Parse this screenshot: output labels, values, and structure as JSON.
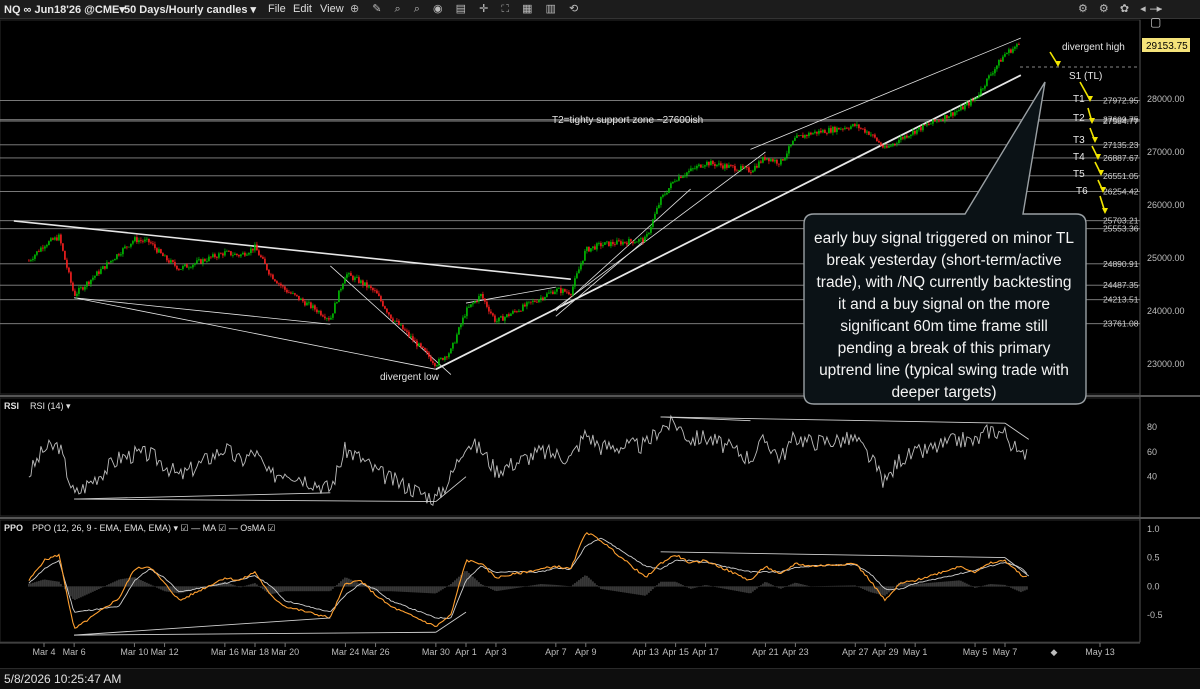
{
  "toolbar": {
    "symbol": "NQ ∞ Jun18'26 @CME▾",
    "period": "50 Days/Hourly candles ▾",
    "menu_file": "File",
    "menu_edit": "Edit",
    "menu_view": "View",
    "left_tools": "⊕ ✎ ⌕ ⌕ ◉ ▤ ✛ ⛶ ▦ ▥ ⟲",
    "right_tools": "⚙ ⚙ ✿ ◂ ▸",
    "window_controls": "— ▢"
  },
  "footer": {
    "timestamp": "5/8/2026 10:25:47 AM"
  },
  "colors": {
    "background": "#000000",
    "up_candle": "#00c000",
    "down_candle": "#ff2020",
    "price_tag": "#f5e37a",
    "target_arrow": "#f2e600",
    "rsi_line": "#bdbdbd",
    "ppo_line": "#ffa030",
    "ppo_signal": "#cfcfcf",
    "osma": "#3a3a3a"
  },
  "chart_data": [
    {
      "type": "candlestick",
      "panel": "price",
      "ylim": [
        22600,
        29450
      ],
      "y_ticks": [
        23000,
        24000,
        25000,
        26000,
        27000,
        28000,
        29000
      ],
      "last_price": "29153.75",
      "price_axis_labels": [
        "23000.00",
        "24000.00",
        "25000.00",
        "26000.00",
        "27000.00",
        "28000.00",
        "29000.00"
      ],
      "x_labels": [
        "Mar 4",
        "Mar 6",
        "Mar 10",
        "Mar 12",
        "Mar 16",
        "Mar 18",
        "Mar 20",
        "Mar 24",
        "Mar 26",
        "Mar 30",
        "Apr 1",
        "Apr 3",
        "Apr 7",
        "Apr 9",
        "Apr 13",
        "Apr 15",
        "Apr 17",
        "Apr 21",
        "Apr 23",
        "Apr 27",
        "Apr 29",
        "May 1",
        "May 5",
        "May 7",
        "May 13"
      ],
      "levels": [
        {
          "value": 27972.95,
          "label": "27972.95"
        },
        {
          "value": 27609.75,
          "label": "27609.75"
        },
        {
          "value": 27584.77,
          "label": "27584.77"
        },
        {
          "value": 27135.23,
          "label": "27135.23"
        },
        {
          "value": 26887.67,
          "label": "26887.67"
        },
        {
          "value": 26551.05,
          "label": "26551.05"
        },
        {
          "value": 26254.42,
          "label": "26254.42"
        },
        {
          "value": 25703.21,
          "label": "25703.21"
        },
        {
          "value": 25553.36,
          "label": "25553.36"
        },
        {
          "value": 24890.91,
          "label": "24890.91"
        },
        {
          "value": 24487.35,
          "label": "24487.35"
        },
        {
          "value": 24213.51,
          "label": "24213.51"
        },
        {
          "value": 23761.08,
          "label": "23761.08"
        }
      ],
      "close_path": [
        [
          "Mar 3",
          24950
        ],
        [
          "Mar 4",
          25250
        ],
        [
          "Mar 5",
          25400
        ],
        [
          "Mar 6",
          24300
        ],
        [
          "Mar 9",
          25100
        ],
        [
          "Mar 10",
          25350
        ],
        [
          "Mar 11",
          25300
        ],
        [
          "Mar 12",
          25000
        ],
        [
          "Mar 13",
          24800
        ],
        [
          "Mar 16",
          25100
        ],
        [
          "Mar 17",
          25050
        ],
        [
          "Mar 18",
          25200
        ],
        [
          "Mar 19",
          24700
        ],
        [
          "Mar 20",
          24400
        ],
        [
          "Mar 23",
          23850
        ],
        [
          "Mar 24",
          24700
        ],
        [
          "Mar 25",
          24550
        ],
        [
          "Mar 26",
          24350
        ],
        [
          "Mar 27",
          23900
        ],
        [
          "Mar 30",
          23000
        ],
        [
          "Mar 31",
          23250
        ],
        [
          "Apr 1",
          24000
        ],
        [
          "Apr 2",
          24300
        ],
        [
          "Apr 3",
          23800
        ],
        [
          "Apr 6",
          24250
        ],
        [
          "Apr 7",
          24400
        ],
        [
          "Apr 8",
          24350
        ],
        [
          "Apr 9",
          25150
        ],
        [
          "Apr 10",
          25250
        ],
        [
          "Apr 13",
          25350
        ],
        [
          "Apr 14",
          26100
        ],
        [
          "Apr 15",
          26500
        ],
        [
          "Apr 16",
          26650
        ],
        [
          "Apr 17",
          26800
        ],
        [
          "Apr 20",
          26650
        ],
        [
          "Apr 21",
          26900
        ],
        [
          "Apr 22",
          26800
        ],
        [
          "Apr 23",
          27250
        ],
        [
          "Apr 24",
          27350
        ],
        [
          "Apr 27",
          27500
        ],
        [
          "Apr 28",
          27350
        ],
        [
          "Apr 29",
          27050
        ],
        [
          "Apr 30",
          27250
        ],
        [
          "May 1",
          27400
        ],
        [
          "May 4",
          27800
        ],
        [
          "May 5",
          28000
        ],
        [
          "May 6",
          28450
        ],
        [
          "May 7",
          28850
        ],
        [
          "May 8",
          29050
        ]
      ],
      "annotations": {
        "divergent_high": "divergent high",
        "divergent_low": "divergent low",
        "s1": "S1 (TL)",
        "t2_zone": "T2=tighty support zone ~27600ish",
        "targets": [
          "T1",
          "T2",
          "T3",
          "T4",
          "T5",
          "T6"
        ],
        "callout": "early buy signal triggered on minor TL break yesterday (short-term/active trade), with /NQ currently backtesting it and a buy signal on the more significant 60m time frame still pending a break of this primary uptrend line (typical swing trade with deeper targets)"
      }
    },
    {
      "type": "line",
      "panel": "RSI",
      "title": "RSI",
      "legend": "RSI (14) ▾",
      "ylim": [
        10,
        100
      ],
      "y_ticks": [
        40,
        60,
        80
      ],
      "path": [
        [
          "Mar 3",
          42
        ],
        [
          "Mar 4",
          62
        ],
        [
          "Mar 5",
          65
        ],
        [
          "Mar 6",
          25
        ],
        [
          "Mar 9",
          55
        ],
        [
          "Mar 10",
          58
        ],
        [
          "Mar 11",
          58
        ],
        [
          "Mar 12",
          50
        ],
        [
          "Mar 13",
          40
        ],
        [
          "Mar 16",
          63
        ],
        [
          "Mar 17",
          52
        ],
        [
          "Mar 18",
          60
        ],
        [
          "Mar 19",
          40
        ],
        [
          "Mar 20",
          45
        ],
        [
          "Mar 23",
          30
        ],
        [
          "Mar 24",
          62
        ],
        [
          "Mar 25",
          55
        ],
        [
          "Mar 26",
          45
        ],
        [
          "Mar 27",
          38
        ],
        [
          "Mar 30",
          22
        ],
        [
          "Mar 31",
          40
        ],
        [
          "Apr 1",
          68
        ],
        [
          "Apr 2",
          62
        ],
        [
          "Apr 3",
          45
        ],
        [
          "Apr 6",
          60
        ],
        [
          "Apr 7",
          58
        ],
        [
          "Apr 8",
          55
        ],
        [
          "Apr 9",
          75
        ],
        [
          "Apr 10",
          64
        ],
        [
          "Apr 13",
          65
        ],
        [
          "Apr 14",
          80
        ],
        [
          "Apr 15",
          83
        ],
        [
          "Apr 16",
          70
        ],
        [
          "Apr 17",
          72
        ],
        [
          "Apr 20",
          55
        ],
        [
          "Apr 21",
          70
        ],
        [
          "Apr 22",
          55
        ],
        [
          "Apr 23",
          72
        ],
        [
          "Apr 24",
          68
        ],
        [
          "Apr 27",
          70
        ],
        [
          "Apr 28",
          55
        ],
        [
          "Apr 29",
          35
        ],
        [
          "Apr 30",
          55
        ],
        [
          "May 1",
          58
        ],
        [
          "May 4",
          70
        ],
        [
          "May 5",
          68
        ],
        [
          "May 6",
          78
        ],
        [
          "May 7",
          75
        ],
        [
          "May 8",
          55
        ],
        [
          "May 8b",
          66
        ]
      ]
    },
    {
      "type": "line",
      "panel": "PPO",
      "title": "PPO",
      "legend": "PPO (12, 26, 9 - EMA, EMA, EMA) ▾  ☑ — MA ☑ — OsMA ☑",
      "ylim": [
        -0.9,
        1.05
      ],
      "y_ticks": [
        -0.5,
        0.0,
        0.5,
        1.0
      ],
      "y_tick_labels": [
        "-0.5",
        "0.0",
        "0.5",
        "1.0"
      ],
      "series": [
        {
          "name": "PPO",
          "path": [
            [
              "Mar 3",
              0.1
            ],
            [
              "Mar 4",
              0.45
            ],
            [
              "Mar 5",
              0.55
            ],
            [
              "Mar 6",
              -0.75
            ],
            [
              "Mar 9",
              -0.2
            ],
            [
              "Mar 10",
              0.3
            ],
            [
              "Mar 11",
              0.35
            ],
            [
              "Mar 12",
              0.05
            ],
            [
              "Mar 13",
              -0.25
            ],
            [
              "Mar 16",
              0.15
            ],
            [
              "Mar 17",
              0.1
            ],
            [
              "Mar 18",
              0.25
            ],
            [
              "Mar 19",
              -0.15
            ],
            [
              "Mar 20",
              -0.35
            ],
            [
              "Mar 23",
              -0.55
            ],
            [
              "Mar 24",
              0.05
            ],
            [
              "Mar 25",
              0.1
            ],
            [
              "Mar 26",
              -0.15
            ],
            [
              "Mar 27",
              -0.35
            ],
            [
              "Mar 30",
              -0.7
            ],
            [
              "Mar 31",
              -0.5
            ],
            [
              "Apr 1",
              0.45
            ],
            [
              "Apr 2",
              0.4
            ],
            [
              "Apr 3",
              0.15
            ],
            [
              "Apr 6",
              0.3
            ],
            [
              "Apr 7",
              0.35
            ],
            [
              "Apr 8",
              0.3
            ],
            [
              "Apr 9",
              0.95
            ],
            [
              "Apr 10",
              0.8
            ],
            [
              "Apr 13",
              0.15
            ],
            [
              "Apr 14",
              0.4
            ],
            [
              "Apr 15",
              0.55
            ],
            [
              "Apr 16",
              0.4
            ],
            [
              "Apr 17",
              0.45
            ],
            [
              "Apr 20",
              0.1
            ],
            [
              "Apr 21",
              0.35
            ],
            [
              "Apr 22",
              0.2
            ],
            [
              "Apr 23",
              0.4
            ],
            [
              "Apr 24",
              0.35
            ],
            [
              "Apr 27",
              0.4
            ],
            [
              "Apr 28",
              0.1
            ],
            [
              "Apr 29",
              -0.25
            ],
            [
              "Apr 30",
              0.05
            ],
            [
              "May 1",
              0.1
            ],
            [
              "May 4",
              0.35
            ],
            [
              "May 5",
              0.25
            ],
            [
              "May 6",
              0.4
            ],
            [
              "May 7",
              0.45
            ],
            [
              "May 8",
              0.2
            ],
            [
              "May 8b",
              0.15
            ]
          ]
        },
        {
          "name": "MA",
          "path": [
            [
              "Mar 3",
              0.05
            ],
            [
              "Mar 4",
              0.3
            ],
            [
              "Mar 5",
              0.45
            ],
            [
              "Mar 6",
              -0.45
            ],
            [
              "Mar 9",
              -0.35
            ],
            [
              "Mar 10",
              0.1
            ],
            [
              "Mar 11",
              0.3
            ],
            [
              "Mar 12",
              0.15
            ],
            [
              "Mar 13",
              -0.1
            ],
            [
              "Mar 16",
              0.05
            ],
            [
              "Mar 17",
              0.12
            ],
            [
              "Mar 18",
              0.18
            ],
            [
              "Mar 19",
              0.02
            ],
            [
              "Mar 20",
              -0.25
            ],
            [
              "Mar 23",
              -0.45
            ],
            [
              "Mar 24",
              -0.15
            ],
            [
              "Mar 25",
              0.05
            ],
            [
              "Mar 26",
              -0.05
            ],
            [
              "Mar 27",
              -0.25
            ],
            [
              "Mar 30",
              -0.55
            ],
            [
              "Mar 31",
              -0.55
            ],
            [
              "Apr 1",
              0.1
            ],
            [
              "Apr 2",
              0.35
            ],
            [
              "Apr 3",
              0.25
            ],
            [
              "Apr 6",
              0.25
            ],
            [
              "Apr 7",
              0.32
            ],
            [
              "Apr 8",
              0.3
            ],
            [
              "Apr 9",
              0.7
            ],
            [
              "Apr 10",
              0.85
            ],
            [
              "Apr 13",
              0.35
            ],
            [
              "Apr 14",
              0.3
            ],
            [
              "Apr 15",
              0.45
            ],
            [
              "Apr 16",
              0.45
            ],
            [
              "Apr 17",
              0.42
            ],
            [
              "Apr 20",
              0.25
            ],
            [
              "Apr 21",
              0.25
            ],
            [
              "Apr 22",
              0.25
            ],
            [
              "Apr 23",
              0.32
            ],
            [
              "Apr 24",
              0.35
            ],
            [
              "Apr 27",
              0.38
            ],
            [
              "Apr 28",
              0.22
            ],
            [
              "Apr 29",
              -0.05
            ],
            [
              "Apr 30",
              -0.05
            ],
            [
              "May 1",
              0.05
            ],
            [
              "May 4",
              0.22
            ],
            [
              "May 5",
              0.28
            ],
            [
              "May 6",
              0.35
            ],
            [
              "May 7",
              0.42
            ],
            [
              "May 8",
              0.32
            ],
            [
              "May 8b",
              0.2
            ]
          ]
        }
      ]
    }
  ]
}
